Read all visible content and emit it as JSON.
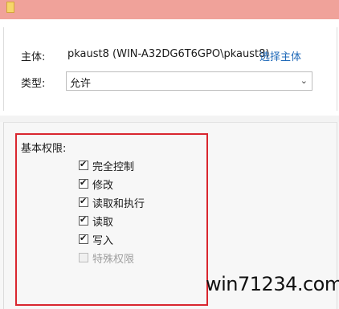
{
  "owner": {
    "label": "主体:",
    "value": "pkaust8 (WIN-A32DG6T6GPO\\pkaust8)",
    "select_link": "选择主体"
  },
  "type": {
    "label": "类型:",
    "selected": "允许"
  },
  "basic_permissions": {
    "heading": "基本权限:",
    "items": [
      {
        "label": "完全控制",
        "checked": true,
        "enabled": true
      },
      {
        "label": "修改",
        "checked": true,
        "enabled": true
      },
      {
        "label": "读取和执行",
        "checked": true,
        "enabled": true
      },
      {
        "label": "读取",
        "checked": true,
        "enabled": true
      },
      {
        "label": "写入",
        "checked": true,
        "enabled": true
      },
      {
        "label": "特殊权限",
        "checked": false,
        "enabled": false
      }
    ]
  },
  "watermark": "win71234.com"
}
